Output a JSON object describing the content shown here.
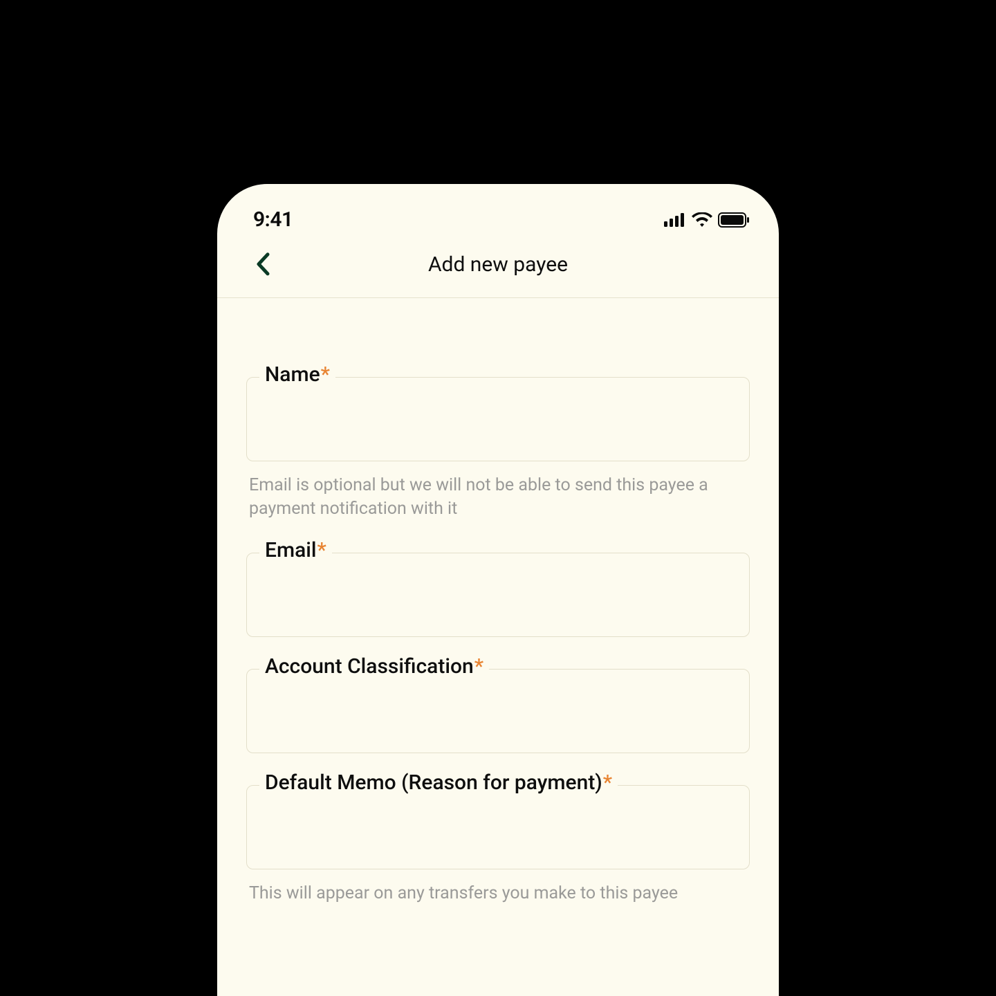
{
  "statusBar": {
    "time": "9:41"
  },
  "nav": {
    "title": "Add new payee"
  },
  "form": {
    "fields": {
      "name": {
        "label": "Name",
        "required": "*",
        "value": ""
      },
      "nameHelper": "Email is optional but we will not be able to send this payee a payment notification with it",
      "email": {
        "label": "Email",
        "required": "*",
        "value": ""
      },
      "accountClassification": {
        "label": "Account Classification",
        "required": "*",
        "value": ""
      },
      "defaultMemo": {
        "label": "Default Memo (Reason for payment)",
        "required": "*",
        "value": ""
      },
      "memoHelper": "This will appear on any transfers you make to this payee"
    }
  }
}
